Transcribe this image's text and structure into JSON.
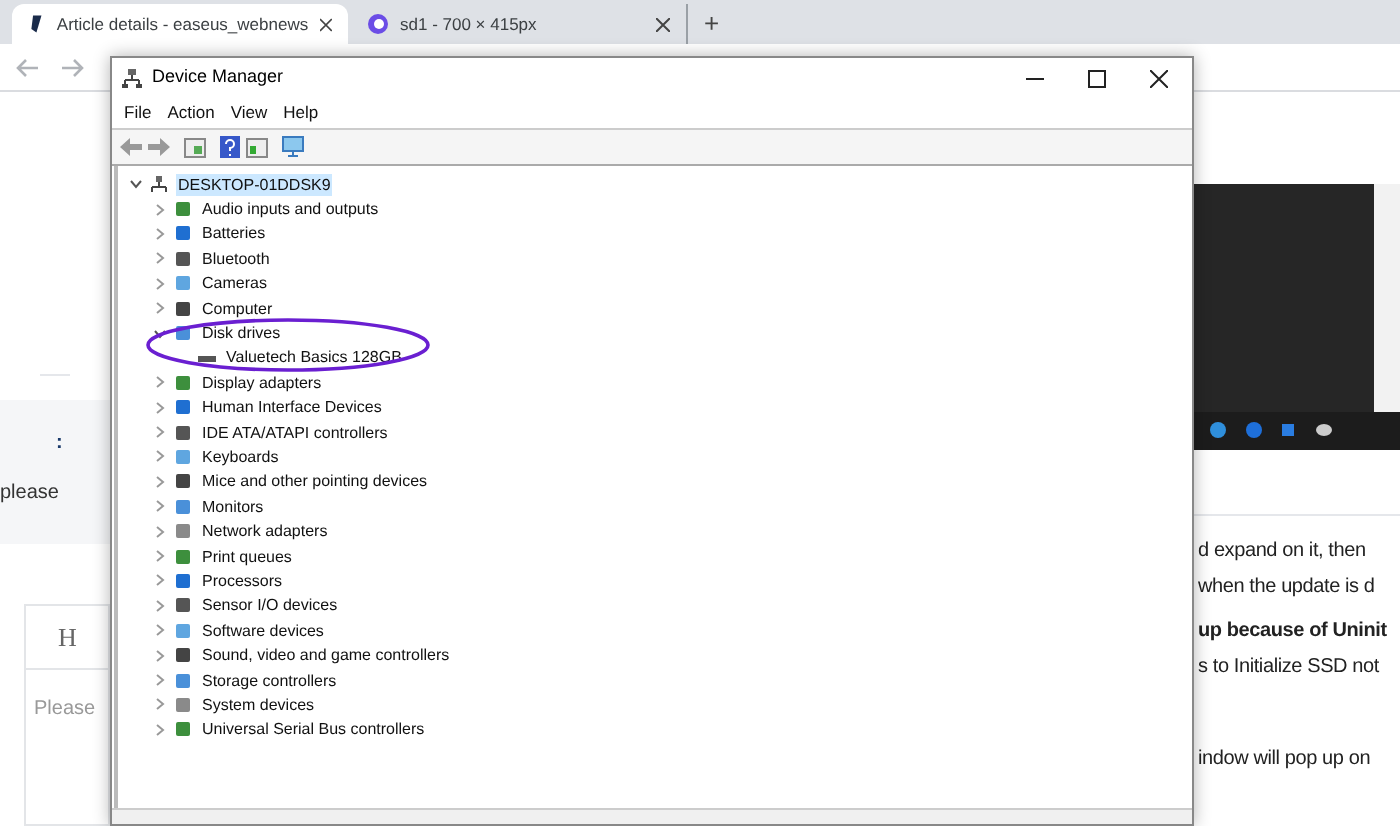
{
  "browser": {
    "tabs": [
      {
        "title": "Article details - easeus_webnews",
        "selected": true
      },
      {
        "title": "sd1 - 700 × 415px",
        "selected": false
      }
    ],
    "new_tab": "+"
  },
  "page": {
    "left_texts": [
      ":",
      "please"
    ],
    "editor": {
      "heading": "H",
      "placeholder": "Please"
    },
    "right_lines": [
      {
        "text": "d expand on it, then",
        "bold": false
      },
      {
        "text": "when the update is d",
        "bold": false
      },
      {
        "text": "up because of Uninit",
        "bold": true
      },
      {
        "text": "s to Initialize SSD not",
        "bold": false
      },
      {
        "text": "indow will pop up on",
        "bold": false
      }
    ]
  },
  "device_manager": {
    "title": "Device Manager",
    "menu": [
      "File",
      "Action",
      "View",
      "Help"
    ],
    "tree": {
      "label": "DESKTOP-01DDSK9",
      "expanded": true,
      "selected": true,
      "children": [
        {
          "label": "Audio inputs and outputs",
          "expanded": false
        },
        {
          "label": "Batteries",
          "expanded": false
        },
        {
          "label": "Bluetooth",
          "expanded": false
        },
        {
          "label": "Cameras",
          "expanded": false
        },
        {
          "label": "Computer",
          "expanded": false
        },
        {
          "label": "Disk drives",
          "expanded": true,
          "children": [
            {
              "label": "Valuetech Basics 128GB"
            }
          ]
        },
        {
          "label": "Display adapters",
          "expanded": false
        },
        {
          "label": "Human Interface Devices",
          "expanded": false
        },
        {
          "label": "IDE ATA/ATAPI controllers",
          "expanded": false
        },
        {
          "label": "Keyboards",
          "expanded": false
        },
        {
          "label": "Mice and other pointing devices",
          "expanded": false
        },
        {
          "label": "Monitors",
          "expanded": false
        },
        {
          "label": "Network adapters",
          "expanded": false
        },
        {
          "label": "Print queues",
          "expanded": false
        },
        {
          "label": "Processors",
          "expanded": false
        },
        {
          "label": "Sensor I/O devices",
          "expanded": false
        },
        {
          "label": "Software devices",
          "expanded": false
        },
        {
          "label": "Sound, video and game controllers",
          "expanded": false
        },
        {
          "label": "Storage controllers",
          "expanded": false
        },
        {
          "label": "System devices",
          "expanded": false
        },
        {
          "label": "Universal Serial Bus controllers",
          "expanded": false
        }
      ]
    }
  }
}
